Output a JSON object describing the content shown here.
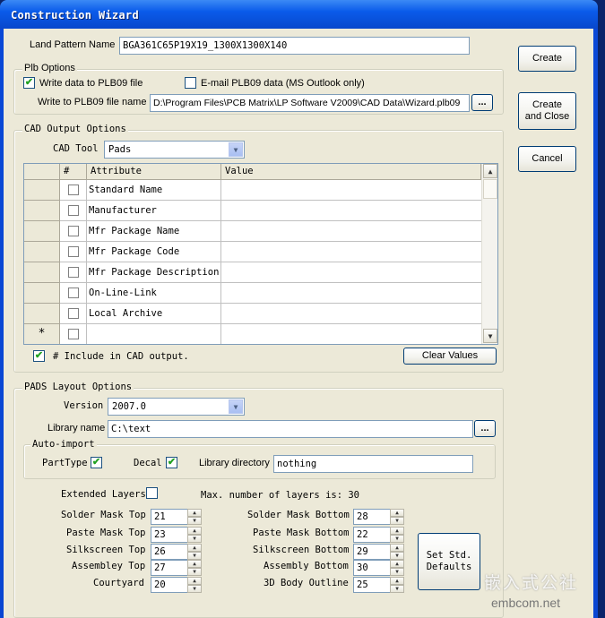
{
  "window": {
    "title": "Construction Wizard"
  },
  "land_pattern": {
    "label": "Land Pattern Name",
    "value": "BGA361C65P19X19_1300X1300X140"
  },
  "plb": {
    "group": "Plb Options",
    "write_data_label": "Write data to PLB09 file",
    "write_data_checked": true,
    "email_label": "E-mail PLB09 data (MS Outlook only)",
    "email_checked": false,
    "file_label": "Write to PLB09 file name",
    "file_value": "D:\\Program Files\\PCB Matrix\\LP Software V2009\\CAD Data\\Wizard.plb09",
    "browse": "..."
  },
  "buttons": {
    "create": "Create",
    "create_close_1": "Create",
    "create_close_2": "and Close",
    "cancel": "Cancel"
  },
  "cad": {
    "group": "CAD Output Options",
    "tool_label": "CAD Tool",
    "tool_value": "Pads",
    "headers": {
      "hash": "#",
      "attribute": "Attribute",
      "value": "Value"
    },
    "rows": [
      {
        "attribute": "Standard Name",
        "value": ""
      },
      {
        "attribute": "Manufacturer",
        "value": ""
      },
      {
        "attribute": "Mfr Package Name",
        "value": ""
      },
      {
        "attribute": "Mfr Package Code",
        "value": ""
      },
      {
        "attribute": "Mfr Package Description",
        "value": ""
      },
      {
        "attribute": "On-Line-Link",
        "value": ""
      },
      {
        "attribute": "Local Archive",
        "value": ""
      },
      {
        "attribute": "",
        "value": ""
      }
    ],
    "new_row_marker": "*",
    "include_label": "# Include in CAD output.",
    "include_checked": true,
    "clear_button": "Clear Values"
  },
  "pads": {
    "group": "PADS Layout Options",
    "version_label": "Version",
    "version_value": "2007.0",
    "library_label": "Library name",
    "library_value": "C:\\text",
    "browse": "...",
    "auto_import": {
      "group": "Auto-import",
      "parttype_label": "PartType",
      "parttype_checked": true,
      "decal_label": "Decal",
      "decal_checked": true,
      "libdir_label": "Library directory",
      "libdir_value": "nothing"
    },
    "extended_label": "Extended Layers",
    "extended_checked": false,
    "max_layers_text": "Max. number of layers is: 30",
    "layers_left": [
      {
        "label": "Solder Mask Top",
        "value": "21"
      },
      {
        "label": "Paste Mask Top",
        "value": "23"
      },
      {
        "label": "Silkscreen Top",
        "value": "26"
      },
      {
        "label": "Assembley Top",
        "value": "27"
      },
      {
        "label": "Courtyard",
        "value": "20"
      }
    ],
    "layers_right": [
      {
        "label": "Solder Mask Bottom",
        "value": "28"
      },
      {
        "label": "Paste Mask Bottom",
        "value": "22"
      },
      {
        "label": "Silkscreen Bottom",
        "value": "29"
      },
      {
        "label": "Assembly Bottom",
        "value": "30"
      },
      {
        "label": "3D Body Outline",
        "value": "25"
      }
    ],
    "set_defaults_1": "Set Std.",
    "set_defaults_2": "Defaults"
  },
  "watermark": {
    "cn": "嵌入式公社",
    "url": "embcom.net"
  }
}
